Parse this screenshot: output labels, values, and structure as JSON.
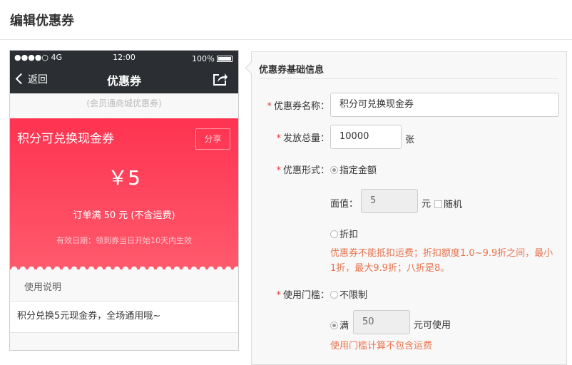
{
  "header": {
    "title": "编辑优惠券"
  },
  "phone": {
    "status": {
      "signal": "●●●●○ 4G",
      "time": "12:00",
      "battery": "100％"
    },
    "nav": {
      "back": "返回",
      "title": "优惠券"
    },
    "subtitle": "(会员通商城优惠券)",
    "coupon": {
      "name": "积分可兑换现金券",
      "share": "分享",
      "amount": "￥5",
      "condition": "订单满 50 元 (不含运费)",
      "validity": "有效日期：领到券当日开始10天内生效"
    },
    "usage": {
      "heading": "使用说明",
      "text": "积分兑换5元现金券，全场通用哦~"
    }
  },
  "form": {
    "title": "优惠券基础信息",
    "name": {
      "label": "优惠券名称：",
      "value": "积分可兑换现金券"
    },
    "total": {
      "label": "发放总量：",
      "value": "10000",
      "unit": "张"
    },
    "type": {
      "label": "优惠形式：",
      "fixed": "指定金额",
      "face_label": "面值：",
      "face_value": "5",
      "face_unit": "元",
      "random": "随机",
      "discount": "折扣",
      "hint": "优惠券不能抵扣运费；折扣额度1.0~9.9折之间，最小1折，最大9.9折；八折是8。"
    },
    "threshold": {
      "label": "使用门槛：",
      "none": "不限制",
      "full": "满",
      "full_value": "50",
      "full_suffix": "元可使用",
      "hint": "使用门槛计算不包含运费"
    }
  }
}
